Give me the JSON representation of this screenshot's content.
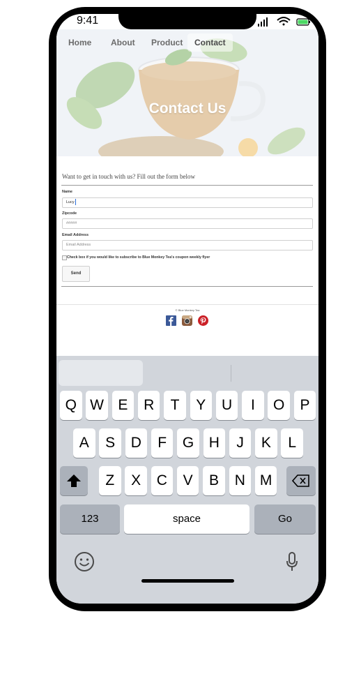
{
  "status": {
    "time": "9:41"
  },
  "nav": [
    "Home",
    "About",
    "Product",
    "Contact"
  ],
  "hero": {
    "title": "Contact Us"
  },
  "form": {
    "intro": "Want to get in touch with us? Fill out the form below",
    "name_label": "Name",
    "name_value": "Lucy",
    "zip_label": "Zipcode",
    "zip_placeholder": "#####",
    "email_label": "Email Address",
    "email_placeholder": "Email Address",
    "checkbox_label": "Check box if you would like to subscribe to Blue Monkey Tea's coupon weekly flyer",
    "send_label": "Send"
  },
  "footer": {
    "copyright": "© Blue Monkey Tea",
    "social_icons": [
      "facebook-icon",
      "instagram-icon",
      "pinterest-icon"
    ]
  },
  "keyboard": {
    "row1": [
      "Q",
      "W",
      "E",
      "R",
      "T",
      "Y",
      "U",
      "I",
      "O",
      "P"
    ],
    "row2": [
      "A",
      "S",
      "D",
      "F",
      "G",
      "H",
      "J",
      "K",
      "L"
    ],
    "row3": [
      "Z",
      "X",
      "C",
      "V",
      "B",
      "N",
      "M"
    ],
    "numbers_label": "123",
    "space_label": "space",
    "go_label": "Go"
  },
  "colors": {
    "keyboard_bg": "#d1d5db",
    "battery": "#4cd964",
    "facebook": "#3b5998",
    "pinterest": "#cb2027"
  }
}
